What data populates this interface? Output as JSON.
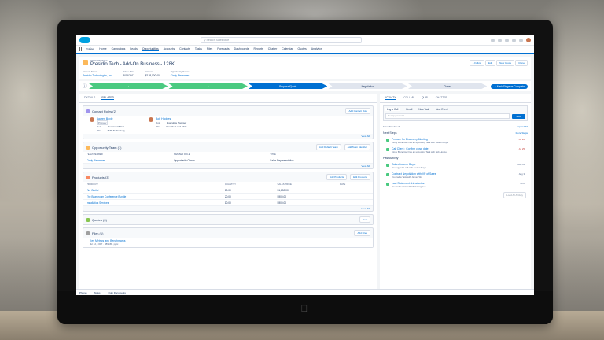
{
  "header": {
    "search_placeholder": "Search Salesforce"
  },
  "nav": {
    "app_name": "Sales",
    "items": [
      "Home",
      "Campaigns",
      "Leads",
      "Opportunities",
      "Accounts",
      "Contacts",
      "Tasks",
      "Files",
      "Forecasts",
      "Dashboards",
      "Reports",
      "Chatter",
      "Calendar",
      "Quotes",
      "Analytics"
    ],
    "active_index": 3
  },
  "record": {
    "type_label": "OPPORTUNITY",
    "title": "Presidio Tech - Add-On Business - 128K",
    "buttons": [
      "+ Follow",
      "Edit",
      "New Quote",
      "Clone"
    ],
    "fields": [
      {
        "label": "Account Name",
        "value": "Presidio Technologies, Inc."
      },
      {
        "label": "Close Date",
        "value": "8/15/2017"
      },
      {
        "label": "Amount",
        "value": "$128,000.00"
      },
      {
        "label": "Opportunity Owner",
        "value": "Cindy Bisnermer"
      }
    ]
  },
  "path": {
    "steps": [
      "✓",
      "✓",
      "Proposal/Quote",
      "Negotiation",
      "Closed"
    ],
    "current_index": 2,
    "mark_button": "✓ Mark Stage as Complete"
  },
  "main": {
    "tabs": [
      "DETAILS",
      "RELATED"
    ],
    "active_tab": 1,
    "contact_roles": {
      "title": "Contact Roles (2)",
      "button": "Add Contact Role",
      "view_all": "View All",
      "people": [
        {
          "name": "Lauren Boyle",
          "badge": "Primary",
          "role_label": "Role",
          "role": "Decision Maker",
          "title_label": "Title",
          "title": "SVP, Technology"
        },
        {
          "name": "Bob Hodges",
          "role_label": "Role",
          "role": "Executive Sponsor",
          "title_label": "Title",
          "title": "President and CEO"
        }
      ]
    },
    "opp_team": {
      "title": "Opportunity Team (1)",
      "buttons": [
        "Add Default Team",
        "Add Team Member"
      ],
      "columns": [
        "TEAM MEMBER",
        "MEMBER ROLE",
        "TITLE"
      ],
      "rows": [
        [
          "Cindy Bisnermer",
          "Opportunity Owner",
          "Sales Representative"
        ]
      ],
      "view_all": "View All"
    },
    "products": {
      "title": "Products (3)",
      "buttons": [
        "Add Products",
        "Edit Products"
      ],
      "columns": [
        "PRODUCT",
        "QUANTITY",
        "SALES PRICE",
        "DATE"
      ],
      "rows": [
        [
          "Tim Oreilel",
          "10.00",
          "$1,800.00",
          ""
        ],
        [
          "The Boardroom Conference Bundle",
          "20.00",
          "$900.00",
          ""
        ],
        [
          "Installation Services",
          "10.00",
          "$900.00",
          ""
        ]
      ],
      "view_all": "View All"
    },
    "quotes": {
      "title": "Quotes (0)",
      "button": "New"
    },
    "files": {
      "title": "Files (1)",
      "button": "Add Files",
      "file_name": "Key Metrics and Benchmarks",
      "file_meta": "Jul 12, 2017 · 389KB · pptx"
    }
  },
  "side": {
    "tabs": [
      "ACTIVITY",
      "COLLAB",
      "QUIP",
      "CHATTER"
    ],
    "active_tab": 0,
    "composer_tabs": [
      "Log a Call",
      "Email",
      "New Task",
      "New Event"
    ],
    "composer_placeholder": "Recap your call...",
    "add_button": "Add",
    "filter_label": "Filter Timeline ▾",
    "expand_all": "Expand All",
    "next_steps": "Next Steps",
    "more_steps": "More Steps",
    "next_items": [
      {
        "title": "Prepare for Discovery Meeting",
        "sub": "Cindy Bisnermer has an upcoming Task with Lauren Boyle",
        "date": "Jul 20"
      },
      {
        "title": "Call Client : Confirm close date",
        "sub": "Cindy Bisnermer has an upcoming Task with Bob Hodges",
        "date": "Jul 25"
      }
    ],
    "past_activity": "Past Activity",
    "past_items": [
      {
        "title": "Called Lauren Boyle",
        "sub": "You logged a call with Lauren Boyle",
        "date": "Aug 11"
      },
      {
        "title": "Contract Negotiation with VP of Sales",
        "sub": "You had a Task with James Wu",
        "date": "Aug 3"
      },
      {
        "title": "Last Statement: Introduction",
        "sub": "You had a Task with Mark Kingston",
        "date": "Jul 8"
      }
    ],
    "load_more": "Load All Activity"
  },
  "footer": {
    "items": [
      "Phone",
      "Notes",
      "Quip Documents"
    ]
  }
}
